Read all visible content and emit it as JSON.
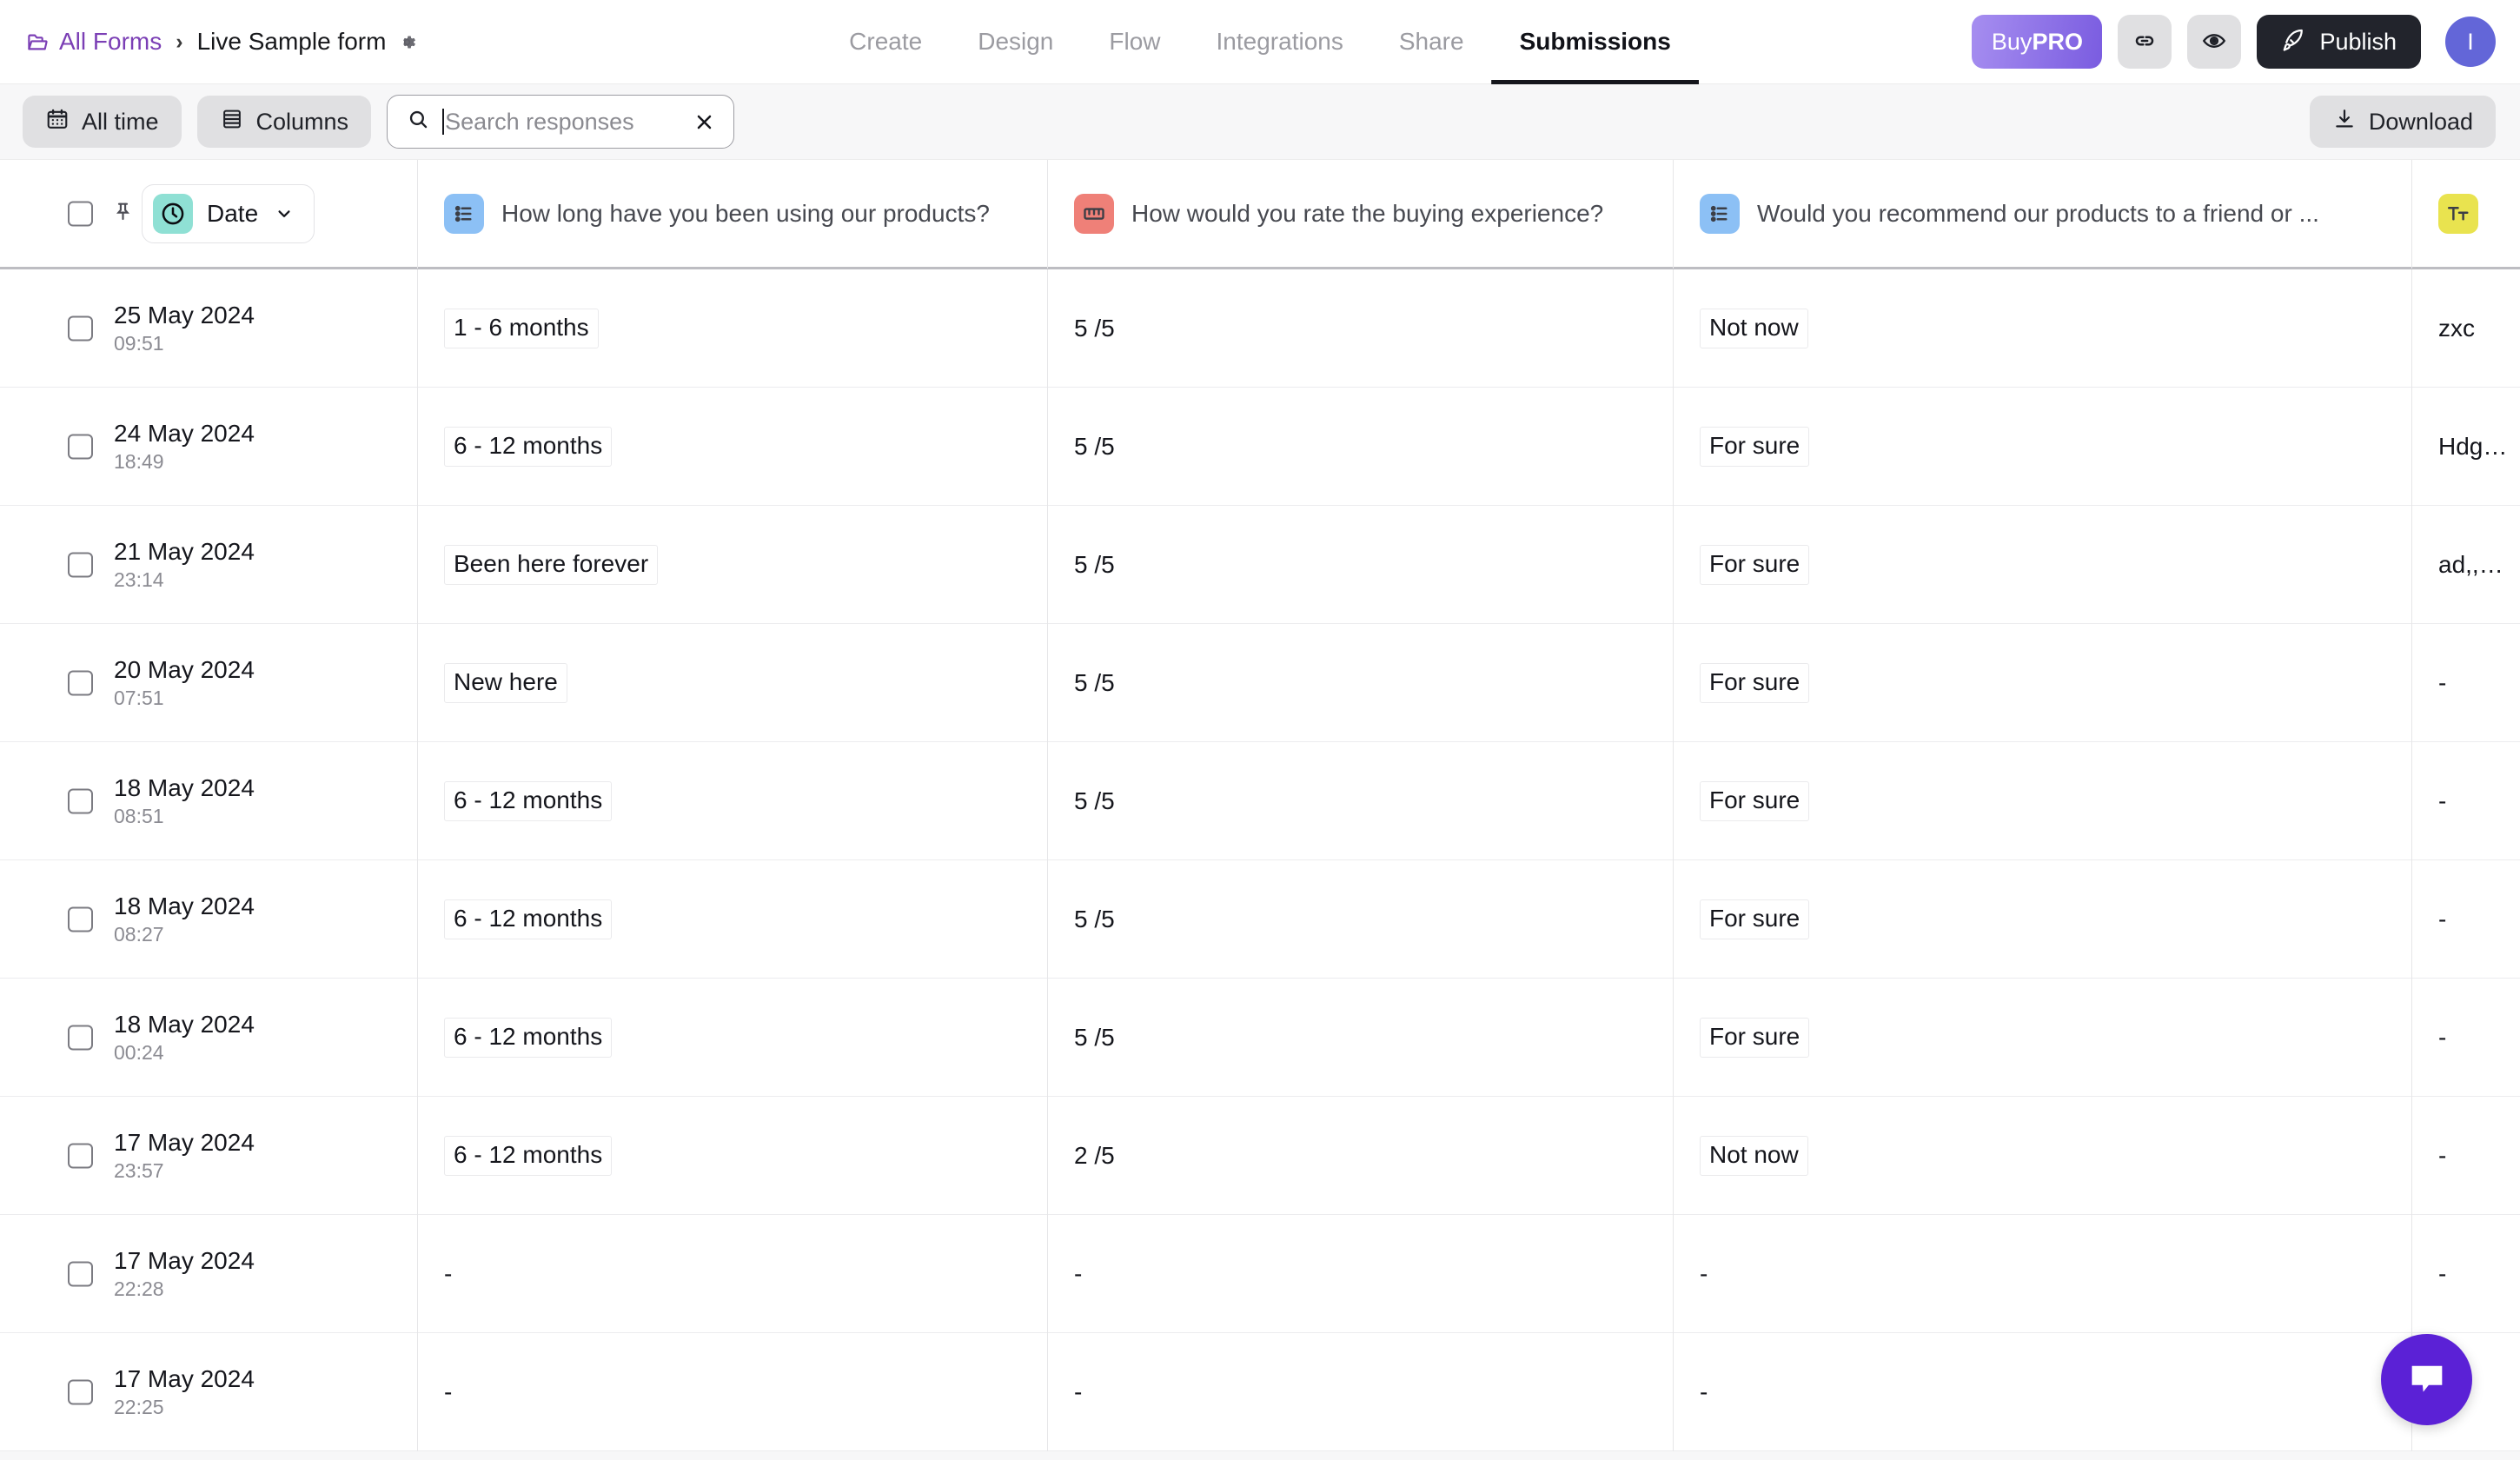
{
  "header": {
    "breadcrumb": {
      "root_label": "All Forms",
      "separator": "›",
      "current_label": "Live Sample form"
    },
    "tabs": [
      {
        "label": "Create",
        "active": false
      },
      {
        "label": "Design",
        "active": false
      },
      {
        "label": "Flow",
        "active": false
      },
      {
        "label": "Integrations",
        "active": false
      },
      {
        "label": "Share",
        "active": false
      },
      {
        "label": "Submissions",
        "active": true
      }
    ],
    "actions": {
      "buy_pro_prefix": "Buy",
      "buy_pro_suffix": "PRO",
      "publish_label": "Publish",
      "avatar_initial": "I"
    }
  },
  "toolbar": {
    "date_filter_label": "All time",
    "columns_label": "Columns",
    "search": {
      "value": "",
      "placeholder": "Search responses"
    },
    "download_label": "Download"
  },
  "table": {
    "columns": [
      {
        "id": "date",
        "label": "Date",
        "icon": "clock-icon",
        "icon_color": "#8fe0d4"
      },
      {
        "id": "q1",
        "label": "How long have you been using our products?",
        "icon": "bullet-list-icon",
        "icon_color": "#8cc0f5"
      },
      {
        "id": "q2",
        "label": "How would you rate the buying experience?",
        "icon": "scale-rating-icon",
        "icon_color": "#ef8078"
      },
      {
        "id": "q3",
        "label": "Would you recommend our products to a friend or ...",
        "icon": "bullet-list-icon",
        "icon_color": "#8cc0f5"
      },
      {
        "id": "q4",
        "label": "",
        "icon": "text-field-icon",
        "icon_color": "#e9e34f"
      }
    ],
    "rows": [
      {
        "date": "25 May 2024",
        "time": "09:51",
        "q1": "1 - 6 months",
        "q1_chip": true,
        "q2": "5 /5",
        "q3": "Not now",
        "q3_chip": true,
        "q4": "zxc"
      },
      {
        "date": "24 May 2024",
        "time": "18:49",
        "q1": "6 - 12 months",
        "q1_chip": true,
        "q2": "5 /5",
        "q3": "For sure",
        "q3_chip": true,
        "q4": "Hdg…"
      },
      {
        "date": "21 May 2024",
        "time": "23:14",
        "q1": "Been here forever",
        "q1_chip": true,
        "q2": "5 /5",
        "q3": "For sure",
        "q3_chip": true,
        "q4": "ad,,…"
      },
      {
        "date": "20 May 2024",
        "time": "07:51",
        "q1": "New here",
        "q1_chip": true,
        "q2": "5 /5",
        "q3": "For sure",
        "q3_chip": true,
        "q4": "-"
      },
      {
        "date": "18 May 2024",
        "time": "08:51",
        "q1": "6 - 12 months",
        "q1_chip": true,
        "q2": "5 /5",
        "q3": "For sure",
        "q3_chip": true,
        "q4": "-"
      },
      {
        "date": "18 May 2024",
        "time": "08:27",
        "q1": "6 - 12 months",
        "q1_chip": true,
        "q2": "5 /5",
        "q3": "For sure",
        "q3_chip": true,
        "q4": "-"
      },
      {
        "date": "18 May 2024",
        "time": "00:24",
        "q1": "6 - 12 months",
        "q1_chip": true,
        "q2": "5 /5",
        "q3": "For sure",
        "q3_chip": true,
        "q4": "-"
      },
      {
        "date": "17 May 2024",
        "time": "23:57",
        "q1": "6 - 12 months",
        "q1_chip": true,
        "q2": "2 /5",
        "q3": "Not now",
        "q3_chip": true,
        "q4": "-"
      },
      {
        "date": "17 May 2024",
        "time": "22:28",
        "q1": "-",
        "q1_chip": false,
        "q2": "-",
        "q3": "-",
        "q3_chip": false,
        "q4": "-"
      },
      {
        "date": "17 May 2024",
        "time": "22:25",
        "q1": "-",
        "q1_chip": false,
        "q2": "-",
        "q3": "-",
        "q3_chip": false,
        "q4": "-"
      }
    ]
  },
  "chat_widget": {
    "icon": "chat-bubble-icon",
    "color": "#5b21d6"
  },
  "colors": {
    "accent_purple": "#7b3fb5",
    "pro_gradient_start": "#a68ef0",
    "pro_gradient_end": "#7a5ce0",
    "publish_bg": "#22242c",
    "avatar_bg": "#6366d8"
  }
}
